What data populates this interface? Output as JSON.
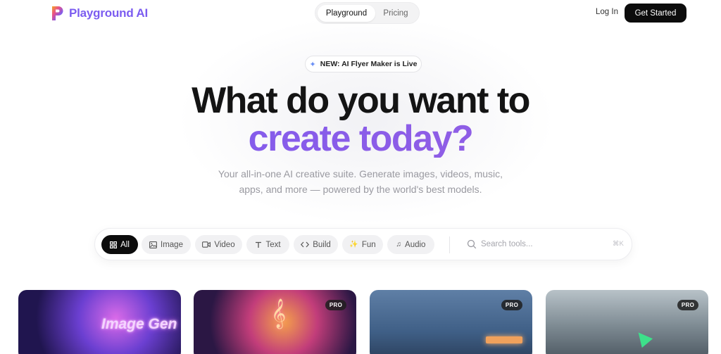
{
  "brand": {
    "name": "Playground AI"
  },
  "nav": {
    "tabs": [
      {
        "label": "Playground",
        "active": true
      },
      {
        "label": "Pricing",
        "active": false
      }
    ],
    "login": "Log In",
    "cta": "Get Started"
  },
  "hero": {
    "badge": "NEW: AI Flyer Maker is Live",
    "headline_line1": "What do you want to",
    "headline_line2": "create today?",
    "subtitle_line1": "Your all-in-one AI creative suite. Generate images, videos, music,",
    "subtitle_line2": "apps, and more — powered by the world's best models."
  },
  "filters": {
    "chips": [
      {
        "label": "All",
        "icon": "grid-icon",
        "active": true
      },
      {
        "label": "Image",
        "icon": "image-icon",
        "active": false
      },
      {
        "label": "Video",
        "icon": "video-icon",
        "active": false
      },
      {
        "label": "Text",
        "icon": "text-icon",
        "active": false
      },
      {
        "label": "Build",
        "icon": "code-icon",
        "active": false
      },
      {
        "label": "Fun",
        "icon": "sparkles-icon",
        "active": false
      },
      {
        "label": "Audio",
        "icon": "music-note-icon",
        "active": false
      }
    ],
    "search_placeholder": "Search tools...",
    "shortcut": "⌘K"
  },
  "cards": [
    {
      "art_text": "Image Gen",
      "badge": ""
    },
    {
      "art_text": "",
      "badge": "PRO"
    },
    {
      "art_text": "",
      "badge": "PRO"
    },
    {
      "art_text": "",
      "badge": "PRO"
    }
  ],
  "colors": {
    "accent_purple": "#7a5cf2",
    "cta_bg": "#0c0c0c",
    "chip_bg": "#f1f1f3"
  }
}
